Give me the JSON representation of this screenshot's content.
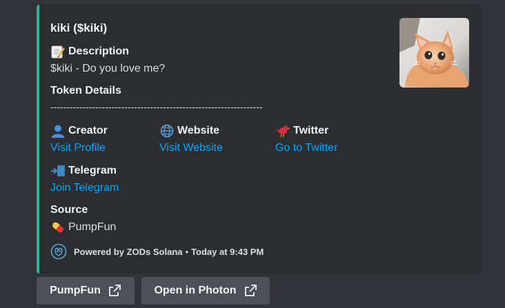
{
  "embed": {
    "accent_color": "#1abc9c",
    "title": "kiki ($kiki)",
    "description_label": "Description",
    "description_text": "$kiki - Do you love me?",
    "token_details_label": "Token Details",
    "divider": "------------------------------------------------------------------",
    "fields": {
      "creator": {
        "label": "Creator",
        "value": "Visit Profile",
        "icon": "bust-icon"
      },
      "website": {
        "label": "Website",
        "value": "Visit Website",
        "icon": "globe-icon"
      },
      "twitter": {
        "label": "Twitter",
        "value": "Go to Twitter",
        "icon": "bird-icon"
      },
      "telegram": {
        "label": "Telegram",
        "value": "Join Telegram",
        "icon": "inbox-arrow-icon"
      }
    },
    "source": {
      "label": "Source",
      "value": "PumpFun",
      "icon": "pill-icon"
    },
    "footer": {
      "text": "Powered by ZODs Solana",
      "separator": "•",
      "timestamp": "Today at 9:43 PM"
    }
  },
  "buttons": [
    {
      "label": "PumpFun",
      "icon": "external-link-icon"
    },
    {
      "label": "Open in Photon",
      "icon": "external-link-icon"
    }
  ],
  "colors": {
    "background": "#313338",
    "embed_bg": "#2b2d31",
    "link": "#00a8fc",
    "button_bg": "#4e5058"
  }
}
